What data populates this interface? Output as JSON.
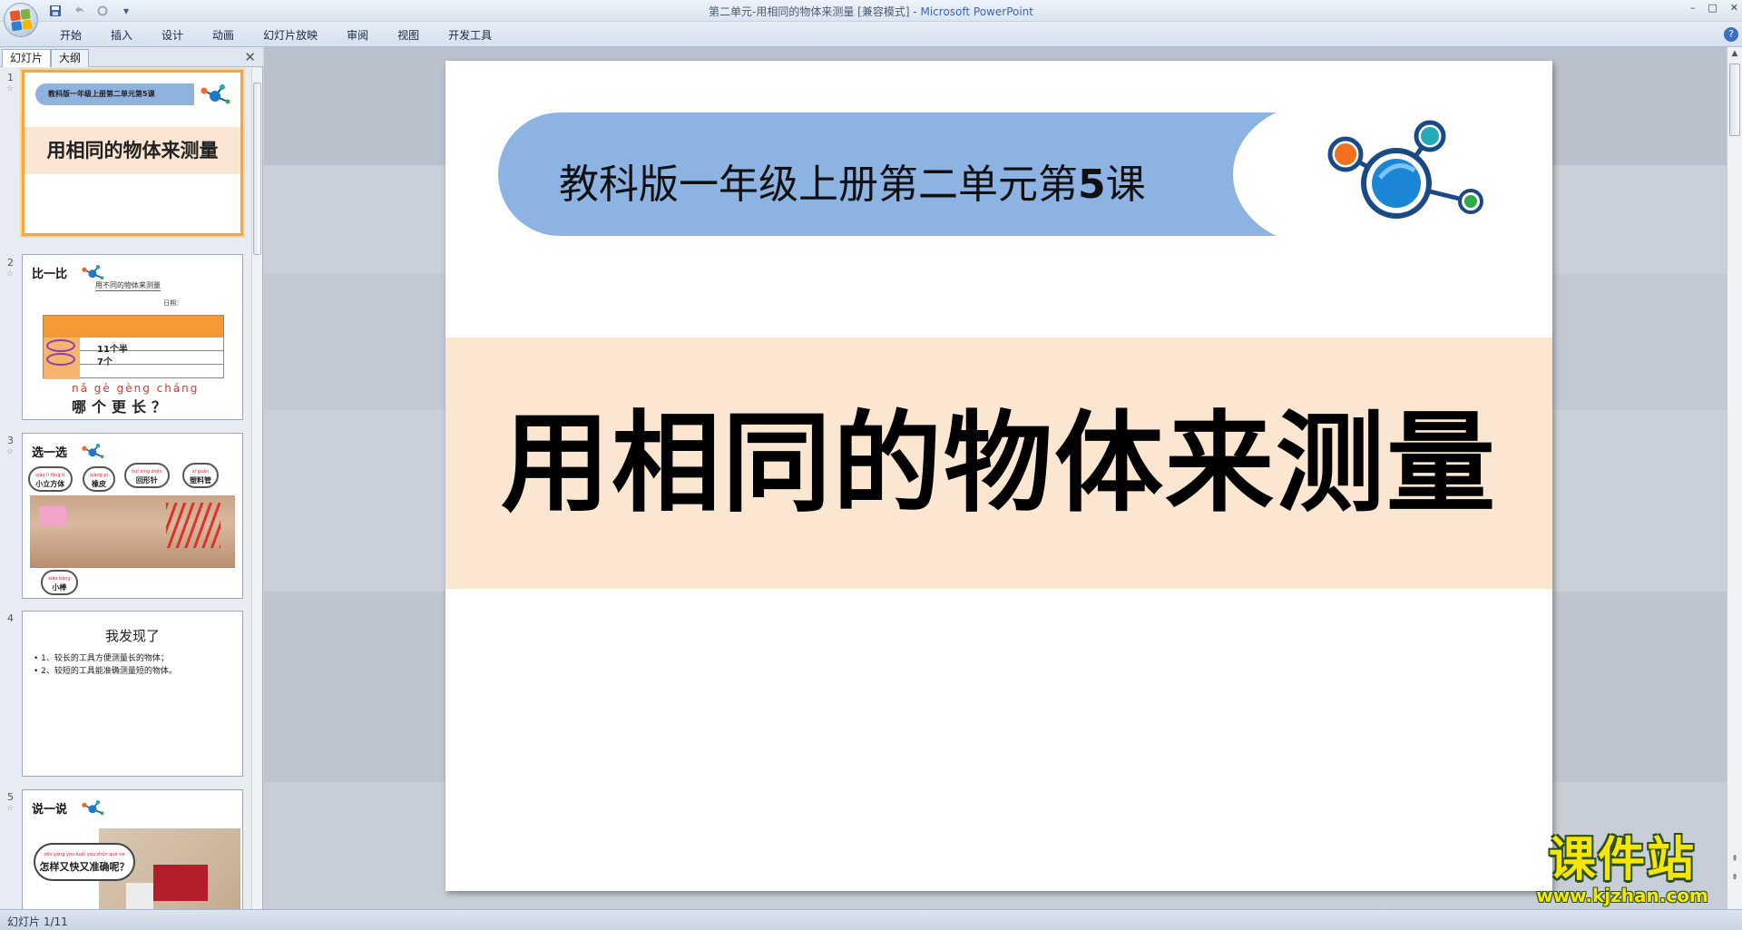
{
  "window": {
    "title": "第二单元-用相同的物体来测量 [兼容模式] - ",
    "app_name": "Microsoft PowerPoint",
    "controls": [
      "–",
      "□",
      "✕"
    ]
  },
  "qat": {
    "save": "save-icon",
    "undo": "undo-icon",
    "redo": "redo-icon",
    "more": "▾"
  },
  "ribbon": {
    "tabs": [
      "开始",
      "插入",
      "设计",
      "动画",
      "幻灯片放映",
      "审阅",
      "视图",
      "开发工具"
    ],
    "help": "?"
  },
  "left_pane": {
    "tabs": [
      "幻灯片",
      "大纲"
    ],
    "close": "✕",
    "slides": [
      {
        "num": "1",
        "banner": "教科版一年级上册第二单元第5课",
        "title": "用相同的物体来测量"
      },
      {
        "num": "2",
        "heading": "比一比",
        "sheet_title": "用不同的物体来测量",
        "name_label": "日期：",
        "cell1": "11个半",
        "cell2": "7个",
        "pinyin": "nǎ gè gèng cháng",
        "question": "哪个更长？"
      },
      {
        "num": "3",
        "heading": "选一选",
        "items": [
          {
            "py": "xiǎo lì fāng tǐ",
            "label": "小立方体"
          },
          {
            "py": "xiàng pí",
            "label": "橡皮"
          },
          {
            "py": "huí xíng zhēn",
            "label": "回形针"
          },
          {
            "py": "xī guǎn",
            "label": "塑料管"
          },
          {
            "py": "xiǎo bàng",
            "label": "小棒"
          }
        ]
      },
      {
        "num": "4",
        "title": "我发现了",
        "lines": [
          "1、较长的工具方便测量长的物体；",
          "2、较短的工具能准确测量短的物体。"
        ]
      },
      {
        "num": "5",
        "heading": "说一说",
        "bubble_py": "zěn yàng yòu kuài yòu zhǔn què ne",
        "bubble": "怎样又快又准确呢？"
      }
    ]
  },
  "slide": {
    "banner_text": "教科版一年级上册第二单元第",
    "banner_num": "5",
    "banner_suffix": "课",
    "title": "用相同的物体来测量"
  },
  "status": {
    "text": "幻灯片 1/11"
  },
  "watermark": {
    "cn": "课件站",
    "url": "www.kjzhan.com"
  },
  "colors": {
    "banner": "#8db3e2",
    "title_band": "#fbe6d2",
    "selection": "#f5a640",
    "watermark": "#f6e600"
  }
}
